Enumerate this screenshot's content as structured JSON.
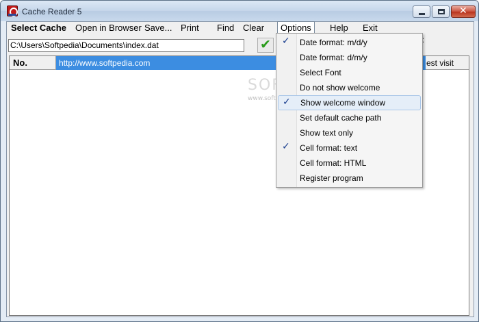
{
  "window": {
    "title": "Cache Reader 5"
  },
  "menubar": {
    "items": [
      {
        "label": "Select Cache",
        "bold": true
      },
      {
        "label": "Open in Browser"
      },
      {
        "label": "Save..."
      },
      {
        "label": "Print"
      },
      {
        "label": "Find"
      },
      {
        "label": "Clear"
      },
      {
        "label": "Options",
        "active": true
      },
      {
        "label": "Help"
      },
      {
        "label": "Exit"
      }
    ]
  },
  "path": {
    "value": "C:\\Users\\Softpedia\\Documents\\index.dat",
    "partial_label": "e:"
  },
  "grid": {
    "col_no": "No.",
    "row_url": "http://www.softpedia.com",
    "col_last": "est visit"
  },
  "watermark": {
    "main": "SOFTPEDIA",
    "small": "www.softpedia.com"
  },
  "options_menu": [
    {
      "label": "Date format: m/d/y",
      "checked": true
    },
    {
      "label": "Date format: d/m/y"
    },
    {
      "label": "Select Font"
    },
    {
      "label": "Do not show welcome"
    },
    {
      "label": "Show welcome window",
      "checked": true,
      "hover": true
    },
    {
      "label": "Set default cache path"
    },
    {
      "label": "Show text only"
    },
    {
      "label": "Cell format: text",
      "checked": true
    },
    {
      "label": "Cell format: HTML"
    },
    {
      "label": "Register program"
    }
  ],
  "icons": {
    "check_glyph": "✔",
    "menu_check_glyph": "✓"
  }
}
